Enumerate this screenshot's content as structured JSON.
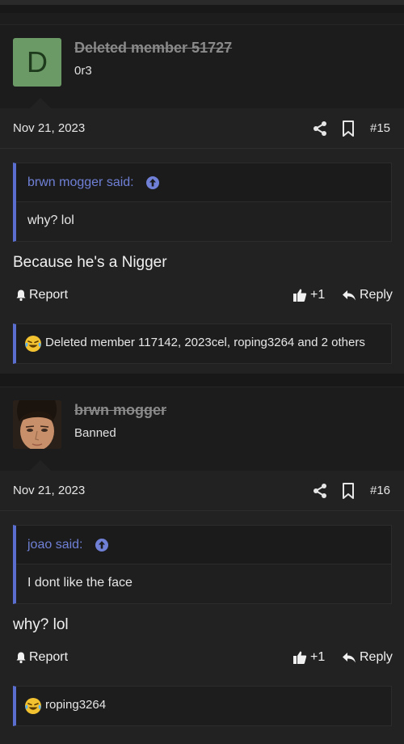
{
  "posts": [
    {
      "avatar_letter": "D",
      "username": "Deleted member 51727",
      "user_title": "0r3",
      "date": "Nov 21, 2023",
      "number": "#15",
      "quote_author": "brwn mogger said:",
      "quote_text": "why? lol",
      "message": "Because he's a Nigger",
      "report_label": "Report",
      "like_label": "+1",
      "reply_label": "Reply",
      "reactions_text": "Deleted member 117142, 2023cel, roping3264 and 2 others"
    },
    {
      "username": "brwn mogger",
      "user_title": "Banned",
      "date": "Nov 21, 2023",
      "number": "#16",
      "quote_author": "joao said:",
      "quote_text": "I dont like the face",
      "message": "why? lol",
      "report_label": "Report",
      "like_label": "+1",
      "reply_label": "Reply",
      "reactions_text": "roping3264"
    }
  ],
  "colors": {
    "accent": "#5a6ecf",
    "quote_author": "#6f80d6",
    "avatar_bg": "#6c9a66"
  }
}
